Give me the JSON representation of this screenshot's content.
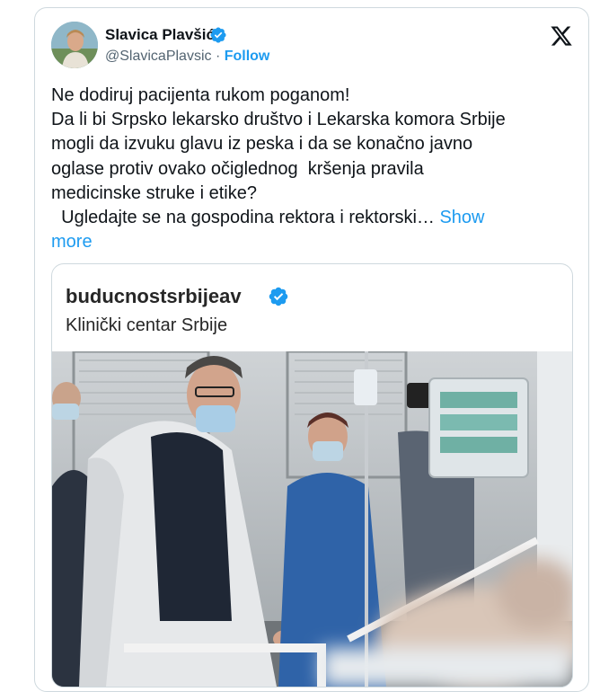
{
  "author": {
    "name": "Slavica Plavšić",
    "handle": "@SlavicaPlavsic",
    "separator": " · ",
    "follow_label": "Follow"
  },
  "tweet": {
    "text": "Ne dodiruj pacijenta rukom poganom!\nDa li bi Srpsko lekarsko društvo i Lekarska komora Srbije\nmogli da izvuku glavu iz peska i da se konačno javno\noglase protiv ovako očiglednog  kršenja pravila\nmedicinske struke i etike?\n  Ugledajte se na gospodina rektora i rektorski… ",
    "show_more_label": "Show\nmore"
  },
  "quote": {
    "account": "buducnostsrbijeav",
    "location": "Klinički centar Srbije"
  },
  "icons": {
    "verified": "verified-badge-icon",
    "platform": "x-logo-icon"
  },
  "colors": {
    "accent": "#1d9bf0",
    "text": "#0f1419",
    "muted": "#536471",
    "border": "#cfd9de"
  }
}
